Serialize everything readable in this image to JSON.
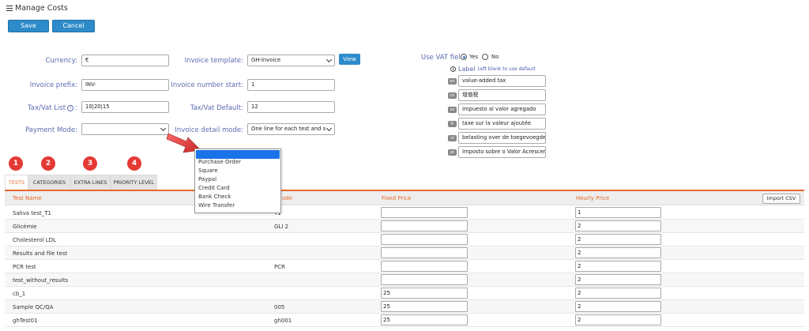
{
  "header": {
    "title": "Manage Costs",
    "save_label": "Save",
    "cancel_label": "Cancel"
  },
  "form": {
    "currency_label": "Currency:",
    "currency_value": "€",
    "invoice_prefix_label": "Invoice prefix:",
    "invoice_prefix_value": "INV-",
    "taxvat_list_label": "Tax/Vat List",
    "taxvat_list_value": "10|20|15",
    "payment_mode_label": "Payment Mode:",
    "payment_mode_value": "",
    "invoice_template_label": "Invoice template:",
    "invoice_template_value": "GH-Invoice",
    "view_label": "View",
    "invoice_number_start_label": "Invoice number start:",
    "invoice_number_start_value": "1",
    "taxvat_default_label": "Tax/Vat Default:",
    "taxvat_default_value": "12",
    "invoice_detail_mode_label": "Invoice detail mode:",
    "invoice_detail_mode_value": "One line for each test and s"
  },
  "vat": {
    "use_vat_label": "Use VAT field:",
    "yes_label": "Yes",
    "no_label": "No",
    "yes_selected": true,
    "label_title": "Label",
    "label_hint": "Left blank to use default",
    "languages": [
      {
        "code": "en",
        "value": "value-added tax"
      },
      {
        "code": "cn",
        "value": "增值税"
      },
      {
        "code": "es",
        "value": "impuesto al valor agregado"
      },
      {
        "code": "fr",
        "value": "taxe sur la valeur ajoutée"
      },
      {
        "code": "nl",
        "value": "belasting over de toegevoegde"
      },
      {
        "code": "pt",
        "value": "imposto sobre o Valor Acrescentado"
      }
    ]
  },
  "payment_dropdown": {
    "options": [
      "",
      "Purchase Order",
      "Square",
      "Paypal",
      "Credit Card",
      "Bank Check",
      "Wire Transfer"
    ],
    "highlighted_index": 0
  },
  "annotations": {
    "badges": [
      "1",
      "2",
      "3",
      "4"
    ]
  },
  "tabs": [
    {
      "label": "TESTS",
      "active": true
    },
    {
      "label": "CATEGORIES",
      "active": false
    },
    {
      "label": "EXTRA LINES",
      "active": false
    },
    {
      "label": "PRIORITY LEVEL",
      "active": false
    }
  ],
  "table": {
    "headers": {
      "test_name": "Test Name",
      "code": "ode",
      "fixed_price": "Fixed Price",
      "hourly_price": "Hourly Price"
    },
    "import_label": "Import CSV",
    "rows": [
      {
        "name": "Saliva test_T1",
        "code": "T1",
        "fixed": "",
        "hourly": "1"
      },
      {
        "name": "Glicémie",
        "code": "GLI 2",
        "fixed": "",
        "hourly": "2"
      },
      {
        "name": "Cholesterol LDL",
        "code": "",
        "fixed": "",
        "hourly": "2"
      },
      {
        "name": "Results and file test",
        "code": "",
        "fixed": "",
        "hourly": "2"
      },
      {
        "name": "PCR test",
        "code": "PCR",
        "fixed": "",
        "hourly": "2"
      },
      {
        "name": "test_without_results",
        "code": "",
        "fixed": "",
        "hourly": "2"
      },
      {
        "name": "cb_1",
        "code": "",
        "fixed": "25",
        "hourly": "2"
      },
      {
        "name": "Sample QC/QA",
        "code": "005",
        "fixed": "25",
        "hourly": "2"
      },
      {
        "name": "ghTest01",
        "code": "gh001",
        "fixed": "25",
        "hourly": "2"
      }
    ]
  },
  "colors": {
    "accent": "#e46a2c",
    "primary_button": "#2d8bc9",
    "label": "#5c6bb0",
    "badge": "#e53935",
    "dropdown_highlight": "#1a73e8"
  }
}
